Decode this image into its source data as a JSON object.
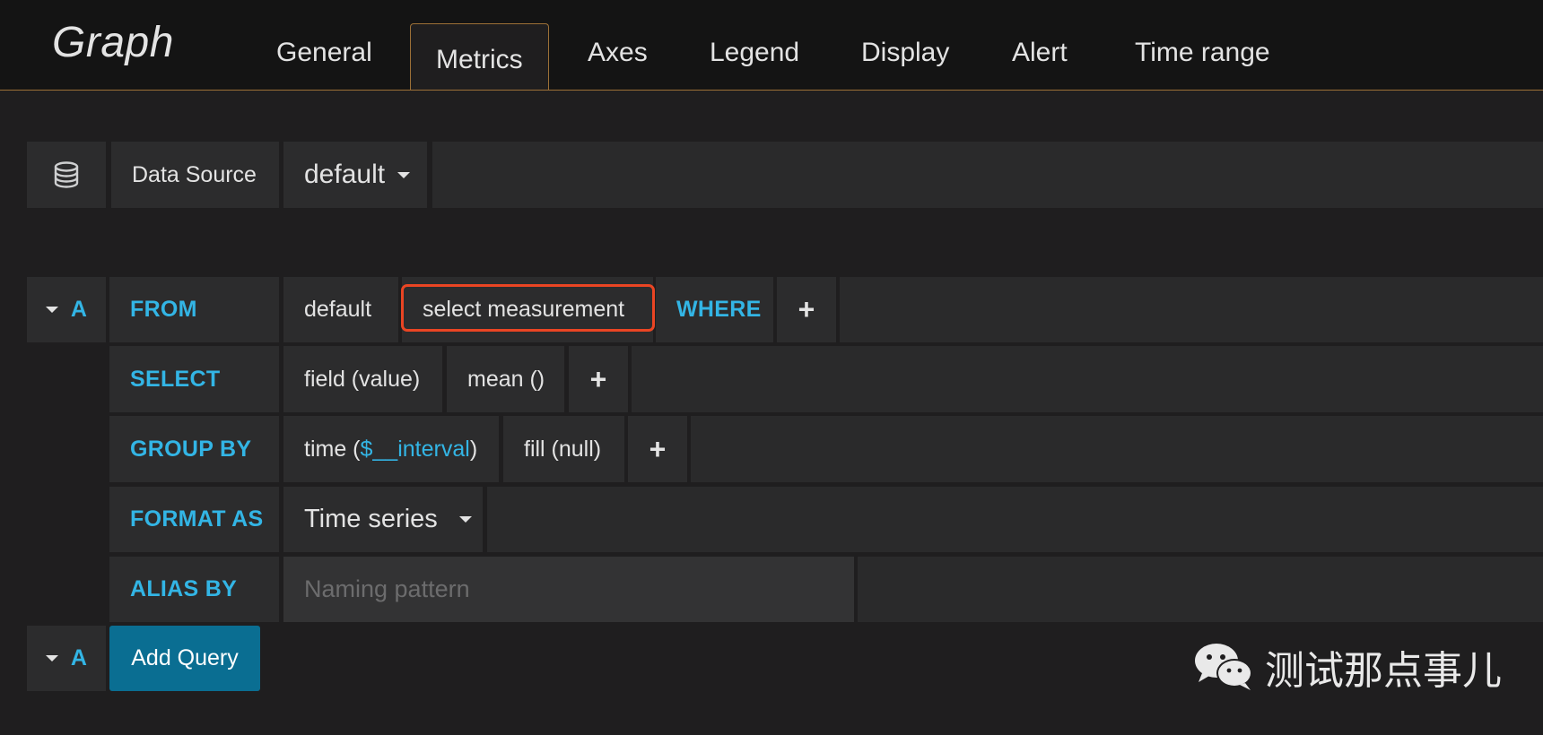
{
  "header": {
    "title": "Graph",
    "tabs": [
      "General",
      "Metrics",
      "Axes",
      "Legend",
      "Display",
      "Alert",
      "Time range"
    ],
    "active_tab": "Metrics"
  },
  "datasource": {
    "icon": "database-icon",
    "label": "Data Source",
    "value": "default"
  },
  "query": {
    "ref_id": "A",
    "from": {
      "keyword": "FROM",
      "policy": "default",
      "measurement": "select measurement",
      "where_keyword": "WHERE"
    },
    "select": {
      "keyword": "SELECT",
      "field": "field (value)",
      "func": "mean ()"
    },
    "group_by": {
      "keyword": "GROUP BY",
      "time_prefix": "time (",
      "interval": "$__interval",
      "time_suffix": ")",
      "fill": "fill (null)"
    },
    "format_as": {
      "keyword": "FORMAT AS",
      "value": "Time series"
    },
    "alias_by": {
      "keyword": "ALIAS BY",
      "placeholder": "Naming pattern"
    },
    "plus": "+"
  },
  "add_query": {
    "ref_id": "A",
    "label": "Add Query"
  },
  "watermark": {
    "text": "测试那点事儿",
    "icon": "wechat-icon"
  },
  "colors": {
    "keyword": "#33b5e5",
    "highlight": "#ea4523",
    "button": "#0a6e92",
    "tab_border": "#9c7037"
  }
}
